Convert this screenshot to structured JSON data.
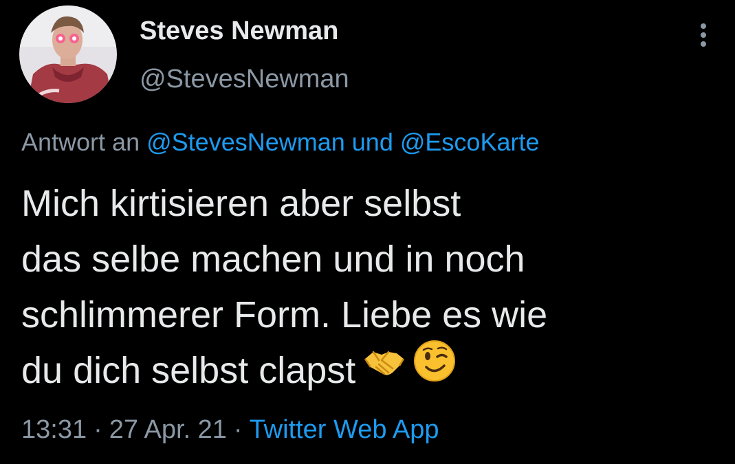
{
  "author": {
    "display_name": "Steves Newman",
    "handle": "@StevesNewman",
    "avatar_icon": "profile-photo"
  },
  "reply": {
    "prefix": "Antwort an",
    "mention_1": "@StevesNewman",
    "conjunction": "und",
    "mention_2": "@EscoKarte"
  },
  "tweet": {
    "lines": [
      "Mich kirtisieren aber selbst",
      "das selbe machen und in noch",
      "schlimmerer Form. Liebe es wie",
      "du dich selbst clapst"
    ],
    "emojis": [
      "handshake-emoji",
      "winking-face-emoji"
    ]
  },
  "meta": {
    "time": "13:31",
    "separator": "·",
    "date": "27 Apr. 21",
    "source": "Twitter Web App"
  },
  "colors": {
    "background": "#000000",
    "text": "#e7e9ea",
    "secondary": "#8b98a5",
    "link": "#1d9bf0"
  },
  "menu_icon": "more-vertical-icon"
}
